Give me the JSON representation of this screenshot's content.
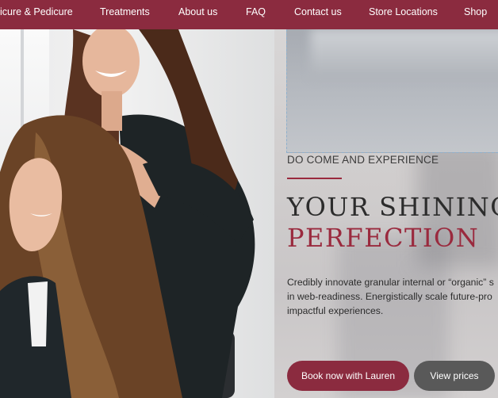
{
  "nav": {
    "items": [
      "icure & Pedicure",
      "Treatments",
      "About us",
      "FAQ",
      "Contact us",
      "Store Locations",
      "Shop"
    ]
  },
  "hero": {
    "kicker": "DO COME AND EXPERIENCE",
    "title_line1": "YOUR SHINING",
    "title_line2": "PERFECTION",
    "description_lines": [
      "Credibly innovate granular internal or “organic” s",
      "in web-readiness. Energistically scale future-pro",
      "impactful experiences."
    ],
    "primary_button": "Book now with Lauren",
    "secondary_button": "View prices"
  },
  "colors": {
    "brand": "#8b2b3f",
    "secondary_button": "#595959"
  }
}
